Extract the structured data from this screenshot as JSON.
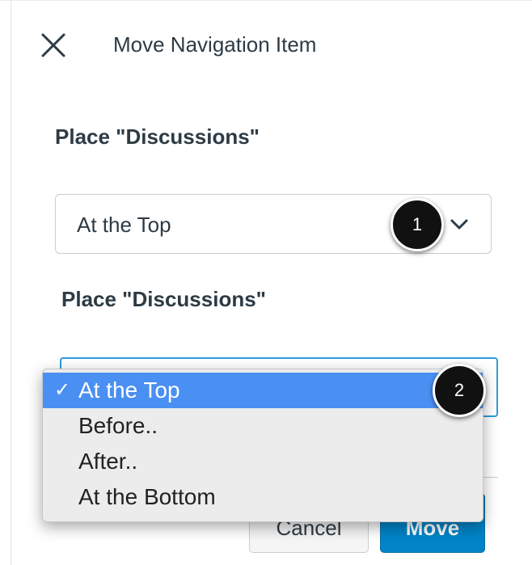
{
  "tray": {
    "title": "Move Navigation Item",
    "close_icon": "close-icon"
  },
  "form": {
    "place_label_1": "Place \"Discussions\"",
    "select_1_value": "At the Top",
    "chevron_icon": "chevron-down-icon",
    "place_label_2": "Place \"Discussions\""
  },
  "callouts": {
    "first": "1",
    "second": "2"
  },
  "dropdown": {
    "checkmark": "✓",
    "options": [
      {
        "label": "At the Top",
        "selected": true
      },
      {
        "label": "Before..",
        "selected": false
      },
      {
        "label": "After..",
        "selected": false
      },
      {
        "label": "At the Bottom",
        "selected": false
      }
    ]
  },
  "footer": {
    "cancel_label": "Cancel",
    "move_label": "Move"
  },
  "colors": {
    "primary": "#0084c7",
    "text": "#2d3b45",
    "focus": "#2d9cdb",
    "menu_selected": "#4a8ff2"
  }
}
